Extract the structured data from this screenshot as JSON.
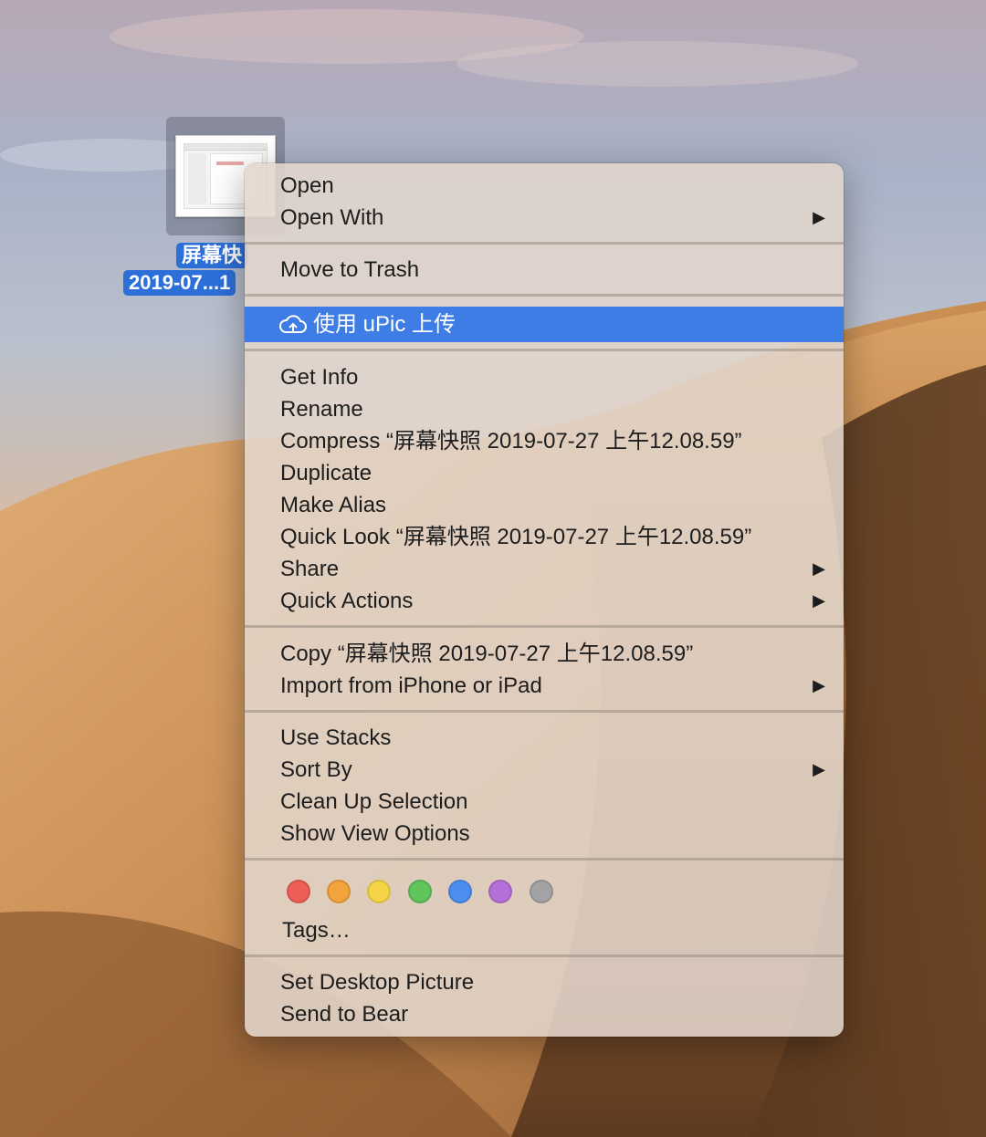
{
  "desktop_file": {
    "name_line1": "屏幕快",
    "name_line2": "2019-07...1"
  },
  "menu": {
    "items": [
      {
        "label": "Open"
      },
      {
        "label": "Open With",
        "submenu": true
      },
      {
        "label": "Move to Trash"
      },
      {
        "label": "使用 uPic 上传",
        "icon": "cloud-upload-icon",
        "highlighted": true
      },
      {
        "label": "Get Info"
      },
      {
        "label": "Rename"
      },
      {
        "label": "Compress “屏幕快照 2019-07-27 上午12.08.59”"
      },
      {
        "label": "Duplicate"
      },
      {
        "label": "Make Alias"
      },
      {
        "label": "Quick Look “屏幕快照 2019-07-27 上午12.08.59”"
      },
      {
        "label": "Share",
        "submenu": true
      },
      {
        "label": "Quick Actions",
        "submenu": true
      },
      {
        "label": "Copy “屏幕快照 2019-07-27 上午12.08.59”"
      },
      {
        "label": "Import from iPhone or iPad",
        "submenu": true
      },
      {
        "label": "Use Stacks"
      },
      {
        "label": "Sort By",
        "submenu": true
      },
      {
        "label": "Clean Up Selection"
      },
      {
        "label": "Show View Options"
      },
      {
        "label": "Tags…"
      },
      {
        "label": "Set Desktop Picture"
      },
      {
        "label": "Send to Bear"
      }
    ],
    "submenu_arrow": "▶",
    "highlight_color": "#3e7de5"
  },
  "tag_colors": [
    {
      "name": "red",
      "color": "#ec5e57"
    },
    {
      "name": "orange",
      "color": "#f2a33c"
    },
    {
      "name": "yellow",
      "color": "#f5d547"
    },
    {
      "name": "green",
      "color": "#5fc45c"
    },
    {
      "name": "blue",
      "color": "#4c8ef0"
    },
    {
      "name": "purple",
      "color": "#b46fd8"
    },
    {
      "name": "gray",
      "color": "#a3a3a6"
    }
  ]
}
